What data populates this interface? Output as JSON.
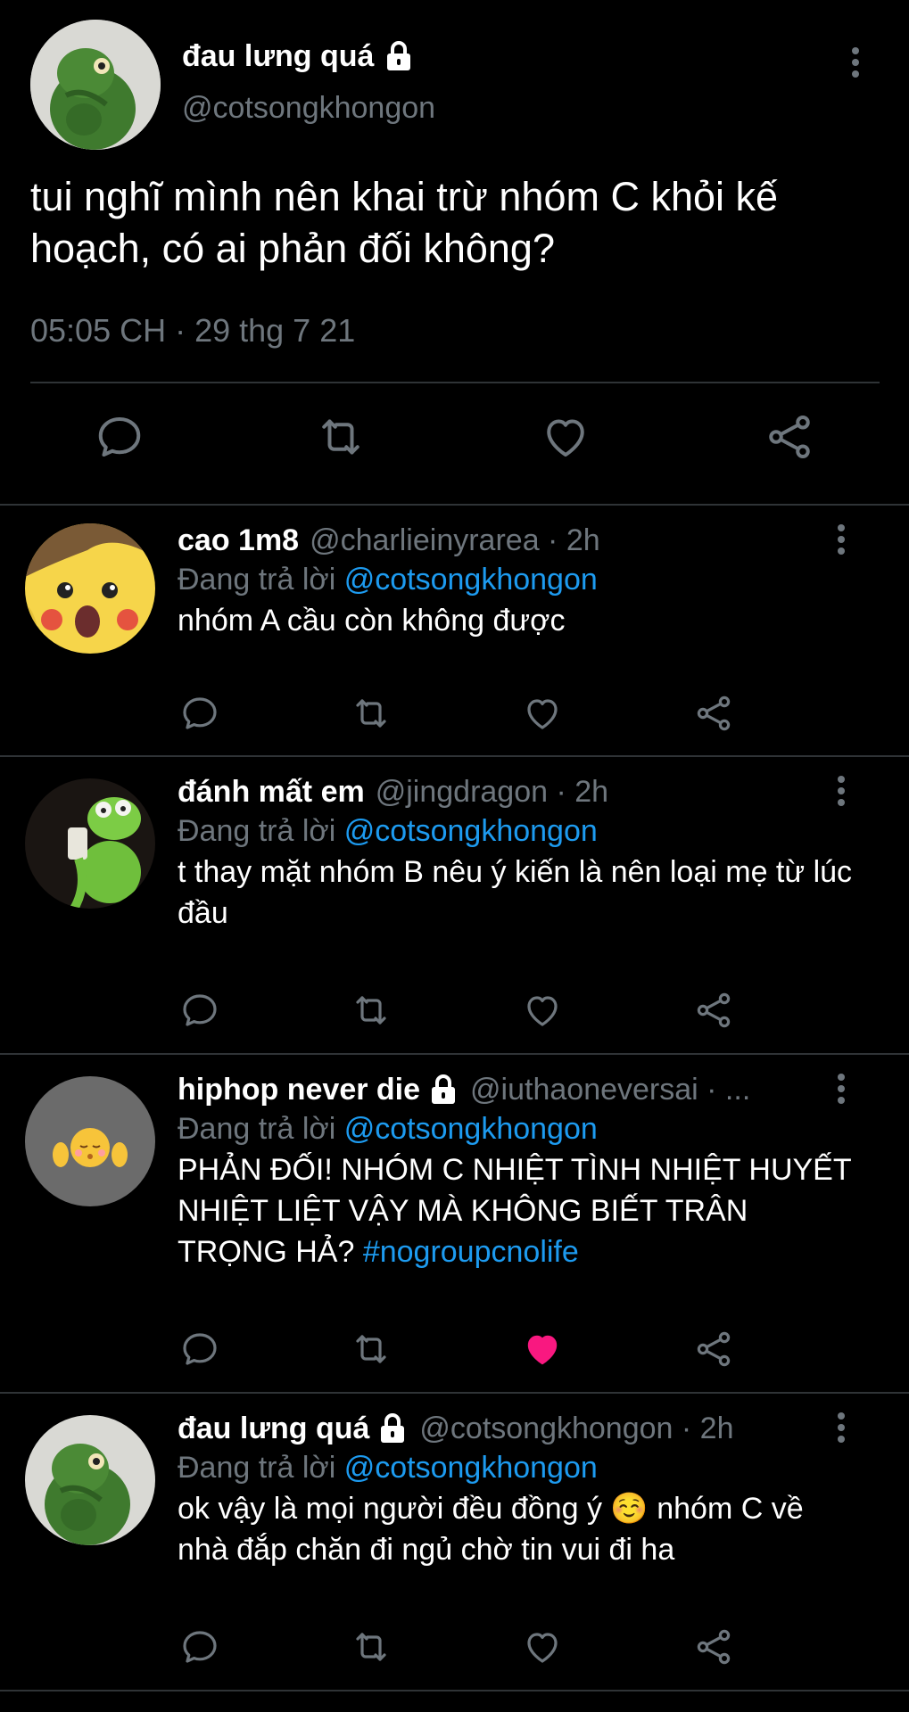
{
  "main_tweet": {
    "name": "đau lưng quá",
    "handle": "@cotsongkhongon",
    "text": "tui nghĩ mình nên khai trừ nhóm C khỏi kế hoạch, có ai phản đối không?",
    "time": "05:05 CH · 29 thg 7 21",
    "locked": true
  },
  "replies": [
    {
      "name": "cao 1m8",
      "handle": "@charlieinyrarea",
      "time": "2h",
      "locked": false,
      "replying_prefix": "Đang trả lời",
      "replying_to": "@cotsongkhongon",
      "text": "nhóm A cầu còn không được",
      "liked": false,
      "avatar": "pikachu"
    },
    {
      "name": "đánh mất em",
      "handle": "@jingdragon",
      "time": "2h",
      "locked": false,
      "replying_prefix": "Đang trả lời",
      "replying_to": "@cotsongkhongon",
      "text": "t thay mặt nhóm B nêu ý kiến là nên loại mẹ từ lúc đầu",
      "liked": false,
      "avatar": "kermit"
    },
    {
      "name": "hiphop never die",
      "handle": "@iuthaoneversai · ...",
      "time": "",
      "locked": true,
      "replying_prefix": "Đang trả lời",
      "replying_to": "@cotsongkhongon",
      "text": "PHẢN ĐỐI! NHÓM C NHIỆT TÌNH NHIỆT HUYẾT NHIỆT LIỆT VẬY MÀ KHÔNG BIẾT TRÂN TRỌNG HẢ?",
      "hashtag": "#nogroupcnolife",
      "liked": true,
      "avatar": "emoji"
    },
    {
      "name": "đau lưng quá",
      "handle": "@cotsongkhongon",
      "time": "2h",
      "locked": true,
      "replying_prefix": "Đang trả lời",
      "replying_to": "@cotsongkhongon",
      "text": "ok vậy là mọi người đều đồng ý ☺️ nhóm C về nhà đắp chăn đi ngủ chờ tin vui đi ha",
      "liked": false,
      "avatar": "frog"
    }
  ],
  "icons": {
    "reply": "speech-bubble-icon",
    "retweet": "retweet-icon",
    "like": "heart-icon",
    "share": "share-icon",
    "more": "vertical-dots-icon",
    "lock": "lock-icon"
  },
  "colors": {
    "background": "#000000",
    "text_primary": "#ffffff",
    "text_secondary": "#6e767d",
    "link": "#1d9bf0",
    "like_active": "#f91880",
    "divider": "#2f3336"
  }
}
